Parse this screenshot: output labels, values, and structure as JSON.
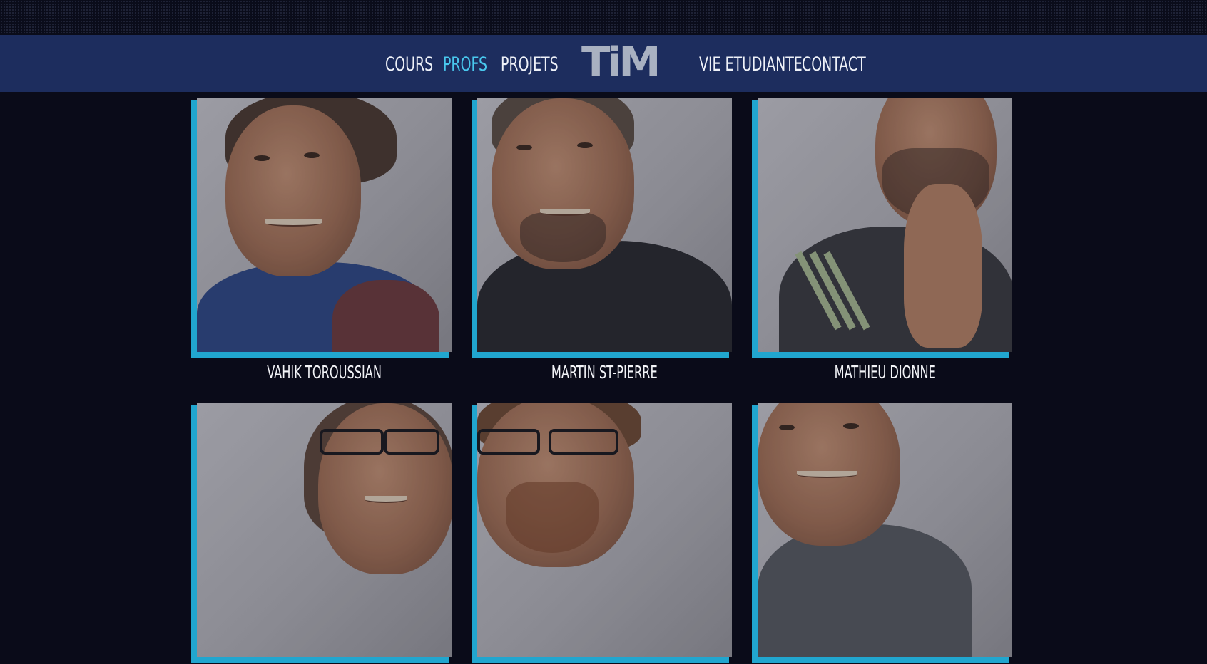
{
  "nav": {
    "items": [
      {
        "label": "COURS",
        "active": false
      },
      {
        "label": "PROFS",
        "active": true
      },
      {
        "label": "PROJETS",
        "active": false
      },
      {
        "label": "VIE ETUDIANTE",
        "active": false
      },
      {
        "label": "CONTACT",
        "active": false
      }
    ],
    "logo_text": "TiM",
    "active_color": "#49c8ee"
  },
  "colors": {
    "page_background": "#0a0b19",
    "navbar_background": "#1d2d5e",
    "card_accent": "#21a6cf"
  },
  "professors": [
    {
      "name": "VAHIK TOROUSSIAN"
    },
    {
      "name": "MARTIN ST-PIERRE"
    },
    {
      "name": "MATHIEU DIONNE"
    },
    {
      "name": ""
    },
    {
      "name": ""
    },
    {
      "name": ""
    }
  ]
}
